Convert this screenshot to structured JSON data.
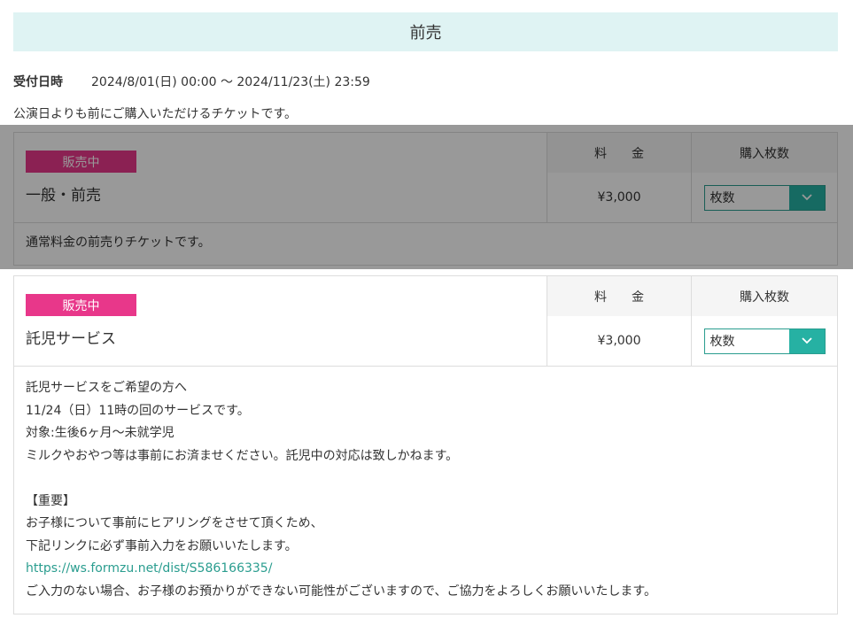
{
  "section": {
    "title": "前売"
  },
  "reception": {
    "label": "受付日時",
    "value": "2024/8/01(日) 00:00 〜 2024/11/23(土) 23:59"
  },
  "description": "公演日よりも前にご購入いただけるチケットです。",
  "columns": {
    "price": "料　　金",
    "quantity": "購入枚数"
  },
  "colors": {
    "badge": "#e8378a",
    "accent": "#26b1a3",
    "header_bg": "#dff3f3"
  },
  "tickets": [
    {
      "badge": "販売中",
      "name": "一般・前売",
      "price": "¥3,000",
      "select_placeholder": "枚数",
      "note_lines": [
        "通常料金の前売りチケットです。"
      ]
    },
    {
      "badge": "販売中",
      "name": "託児サービス",
      "price": "¥3,000",
      "select_placeholder": "枚数",
      "note_lines": [
        "託児サービスをご希望の方へ",
        "11/24（日）11時の回のサービスです。",
        "対象:生後6ヶ月〜未就学児",
        "ミルクやおやつ等は事前にお済ませください。託児中の対応は致しかねます。",
        "",
        "【重要】",
        "お子様について事前にヒアリングをさせて頂くため、",
        "下記リンクに必ず事前入力をお願いいたします。"
      ],
      "link": "https://ws.formzu.net/dist/S586166335/",
      "note_after_link": "ご入力のない場合、お子様のお預かりができない可能性がございますので、ご協力をよろしくお願いいたします。"
    }
  ]
}
